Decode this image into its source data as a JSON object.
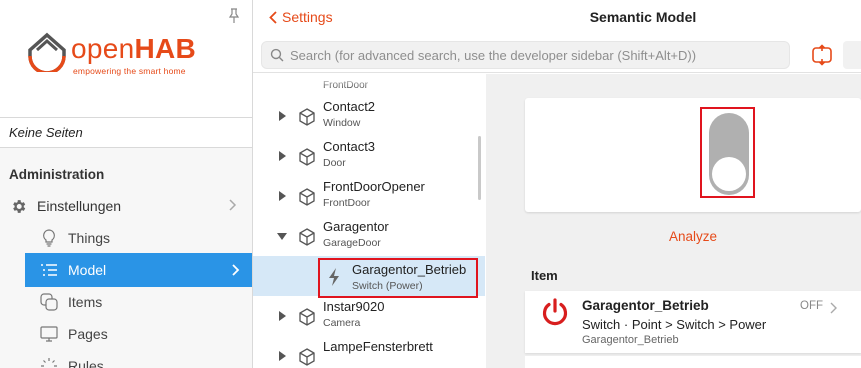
{
  "sidebar": {
    "logo_open": "open",
    "logo_hab": "HAB",
    "logo_tagline": "empowering the smart home",
    "no_pages_label": "Keine Seiten",
    "section_title": "Administration",
    "settings_label": "Einstellungen",
    "sub_items": [
      {
        "label": "Things",
        "icon": "lightbulb-icon"
      },
      {
        "label": "Model",
        "icon": "list-icon"
      },
      {
        "label": "Items",
        "icon": "items-icon"
      },
      {
        "label": "Pages",
        "icon": "monitor-icon"
      },
      {
        "label": "Rules",
        "icon": "rules-icon"
      }
    ]
  },
  "header": {
    "back_label": "Settings",
    "title": "Semantic Model"
  },
  "search": {
    "placeholder": "Search (for advanced search, use the developer sidebar (Shift+Alt+D))"
  },
  "tree": {
    "cut_top_label": "FrontDoor",
    "nodes": [
      {
        "name": "Contact2",
        "type": "Window"
      },
      {
        "name": "Contact3",
        "type": "Door"
      },
      {
        "name": "FrontDoorOpener",
        "type": "FrontDoor"
      },
      {
        "name": "Garagentor",
        "type": "GarageDoor"
      },
      {
        "name": "Instar9020",
        "type": "Camera"
      },
      {
        "name": "LampeFensterbrett",
        "type": ""
      }
    ],
    "selected": {
      "name": "Garagentor_Betrieb",
      "type": "Switch (Power)"
    }
  },
  "detail": {
    "analyze_label": "Analyze",
    "item_section_label": "Item",
    "item": {
      "name": "Garagentor_Betrieb",
      "meta": "Switch · Point > Switch > Power",
      "label": "Garagentor_Betrieb",
      "state": "OFF"
    },
    "toggle_state": "off"
  },
  "colors": {
    "accent": "#e64a19",
    "selection": "#2a94e6",
    "highlight_box": "#e0141e",
    "power_icon": "#d81e1e"
  }
}
